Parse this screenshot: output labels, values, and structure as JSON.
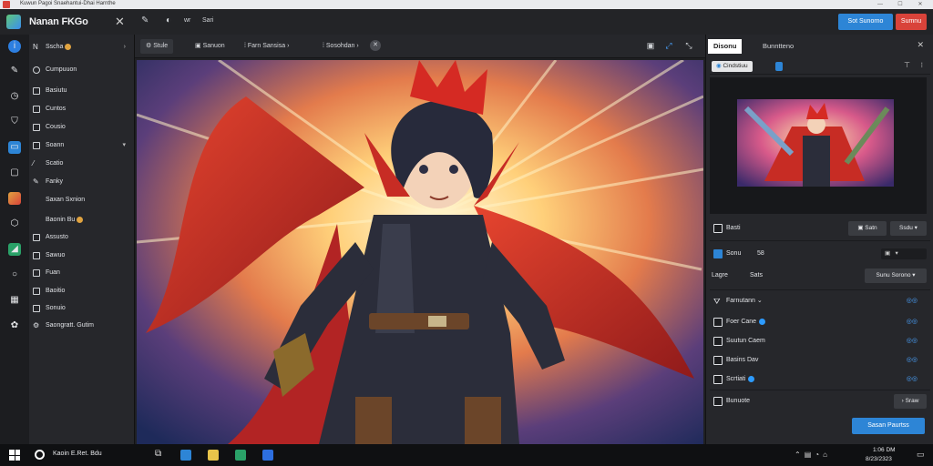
{
  "window": {
    "title": "Kuwun Pagoi Snaehantui-Dhai Harnthe"
  },
  "appbar": {
    "title": "Nanan FKGo",
    "title_icon": "pen-icon",
    "tools": [
      "wr",
      "Sari"
    ],
    "primary_button": "Sot Sunorno",
    "secondary_button": "Sumnu"
  },
  "sidebar": {
    "items": [
      {
        "label": "Sscha",
        "icon": "folder-icon",
        "badge": true,
        "chevron": true
      },
      {
        "label": "Cumpuuon",
        "icon": "square-icon"
      },
      {
        "label": "Basiutu",
        "icon": "square-icon"
      },
      {
        "label": "Cuntos",
        "icon": "square-icon"
      },
      {
        "label": "Cousio",
        "icon": "square-icon"
      },
      {
        "label": "Soann",
        "icon": "square-icon",
        "chevron": true
      },
      {
        "label": "Scatio",
        "icon": "brush-icon"
      },
      {
        "label": "Fanky",
        "icon": "pen-icon"
      },
      {
        "label": "Saxan Sxnion",
        "icon": ""
      },
      {
        "label": "Baonin Bu",
        "icon": "",
        "badge": true
      },
      {
        "label": "Assusto",
        "icon": "square-icon"
      },
      {
        "label": "Sawuo",
        "icon": "square-icon"
      },
      {
        "label": "Fuan",
        "icon": "square-icon"
      },
      {
        "label": "Baoitio",
        "icon": "square-icon"
      },
      {
        "label": "Sonuio",
        "icon": "square-icon"
      },
      {
        "label": "Saongratt. Gutim",
        "icon": "gear-icon"
      }
    ]
  },
  "tabs": {
    "items": [
      "Stule",
      "Sanuon",
      "Farn Sansisa",
      "Sosohdan"
    ],
    "close_icon": "x"
  },
  "panel": {
    "tabs": [
      "Disonu",
      "Bunntteno"
    ],
    "header": "Cindstiuu",
    "section1": {
      "label": "Basti",
      "btn1": "Satn",
      "btn2": "Ssdu"
    },
    "row_sonu": {
      "label": "Sonu",
      "value": "58"
    },
    "row_layer": {
      "label": "Lagre",
      "value": "Sats",
      "dropdown": "Sunu Sorono"
    },
    "layers_header": "Farnutann",
    "layers": [
      {
        "label": "Foer Cane",
        "dot": true
      },
      {
        "label": "Suutun Caem",
        "dot": false
      },
      {
        "label": "Basins Dav",
        "dot": false
      },
      {
        "label": "Scrtiati",
        "dot": true
      }
    ],
    "extra_row": {
      "label": "Bunuote",
      "btn": "Sraw"
    },
    "primary_button": "Sasan Paurtss"
  },
  "taskbar": {
    "search": "Kaoin E.Ret. Bdu",
    "clock": "1:06 DM",
    "date": "8/23/2323"
  }
}
